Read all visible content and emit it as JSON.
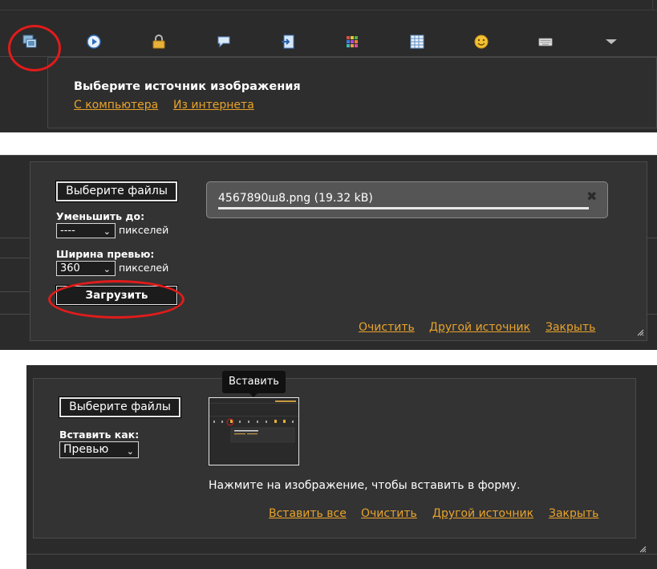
{
  "panel1": {
    "toolbar_icons": [
      "image-insert-icon",
      "play-circle-icon",
      "lock-icon",
      "speech-bubble-icon",
      "document-arrow-icon",
      "color-grid-icon",
      "table-icon",
      "smiley-icon",
      "keyboard-icon",
      "triangle-down-icon"
    ],
    "title": "Выберите источник изображения",
    "link_computer": "С компьютера",
    "link_internet": "Из интернета"
  },
  "panel2": {
    "choose_files": "Выберите файлы",
    "reduce_label": "Уменьшить до:",
    "reduce_value": "----",
    "pixels_1": "пикселей",
    "preview_width_label": "Ширина превью:",
    "preview_width_value": "360",
    "pixels_2": "пикселей",
    "upload": "Загрузить",
    "file_name": "4567890ш8.png (19.32 kB)",
    "upload_progress": 1.0,
    "clear": "Очистить",
    "other_source": "Другой источник",
    "close": "Закрыть"
  },
  "panel3": {
    "choose_files": "Выберите файлы",
    "insert_as_label": "Вставить как:",
    "insert_as_value": "Превью",
    "tooltip": "Вставить",
    "hint": "Нажмите на изображение, чтобы вставить в форму.",
    "insert_all": "Вставить все",
    "clear": "Очистить",
    "other_source": "Другой источник",
    "close": "Закрыть"
  },
  "colors": {
    "background": "#2b2b2b",
    "link": "#e8a32b",
    "annotation": "#e21b1b"
  }
}
